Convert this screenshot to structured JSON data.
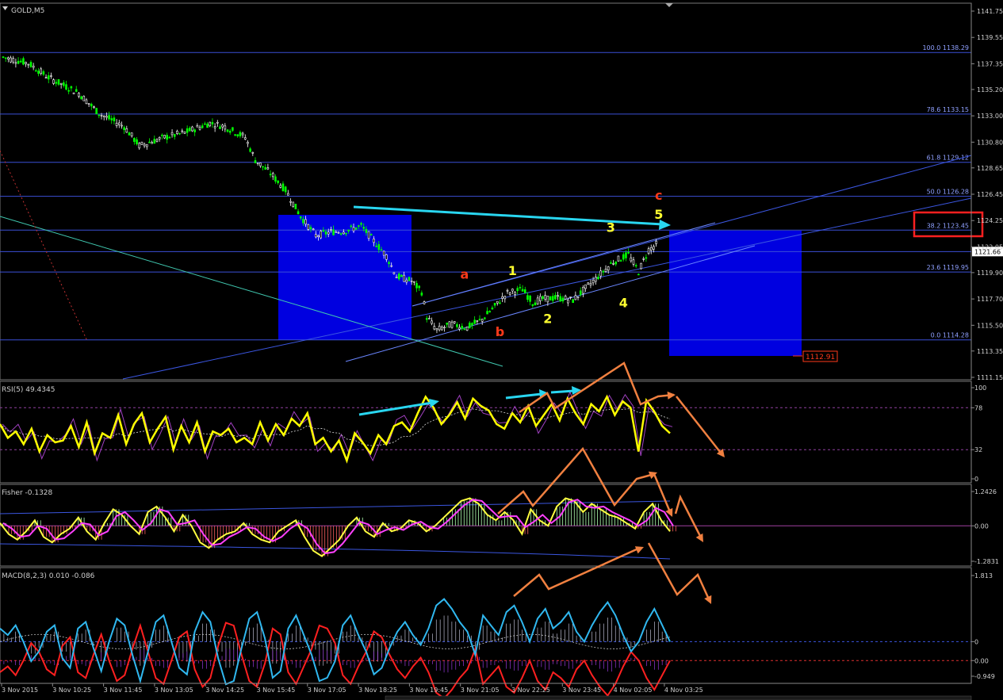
{
  "colors": {
    "background": "#000000",
    "grid": "#8a8a8a",
    "candle_up": "#00ff00",
    "candle_down": "#ffffff",
    "fib_line": "#3b4fd6",
    "zone": "#0000e0",
    "cyan_arrow": "#29d6f0",
    "orange_arrow": "#f08040",
    "rsi_line": "#ffff00",
    "rsi_aux": "#a040c0",
    "fisher_pos": "#b0ffb0",
    "fisher_neg": "#ff6060",
    "fisher_line": "#ffff40",
    "fisher_signal": "#ff40ff",
    "macd_main": "#30b8f0",
    "macd_signal": "#ff2020",
    "target_box": "#ff2020"
  },
  "chart_data": [
    {
      "type": "candlestick",
      "title": "GOLD,M5",
      "ylim": [
        1111.15,
        1141.75
      ],
      "y_ticks": [
        "1141.75",
        "1139.55",
        "1137.35",
        "1135.20",
        "1133.00",
        "1130.80",
        "1128.65",
        "1126.45",
        "1124.25",
        "1122.05",
        "1119.90",
        "1117.70",
        "1115.50",
        "1113.35",
        "1111.15"
      ],
      "x_ticks": [
        "3 Nov 2015",
        "3 Nov 10:25",
        "3 Nov 11:45",
        "3 Nov 13:05",
        "3 Nov 14:25",
        "3 Nov 15:45",
        "3 Nov 17:05",
        "3 Nov 18:25",
        "3 Nov 19:45",
        "3 Nov 21:05",
        "3 Nov 22:25",
        "3 Nov 23:45",
        "4 Nov 02:05",
        "4 Nov 03:25"
      ],
      "bars_count": 260,
      "close_path": [
        [
          0,
          1137.9
        ],
        [
          10,
          1137.4
        ],
        [
          18,
          1136.2
        ],
        [
          30,
          1134.9
        ],
        [
          38,
          1133.2
        ],
        [
          48,
          1132.1
        ],
        [
          54,
          1130.5
        ],
        [
          64,
          1131.2
        ],
        [
          72,
          1131.6
        ],
        [
          82,
          1132.4
        ],
        [
          88,
          1132.1
        ],
        [
          96,
          1131.2
        ],
        [
          100,
          1129.3
        ],
        [
          106,
          1128.2
        ],
        [
          112,
          1126.8
        ],
        [
          118,
          1124.6
        ],
        [
          124,
          1123.0
        ],
        [
          130,
          1123.3
        ],
        [
          136,
          1123.4
        ],
        [
          142,
          1123.8
        ],
        [
          146,
          1122.8
        ],
        [
          152,
          1121.3
        ],
        [
          156,
          1119.6
        ],
        [
          162,
          1119.2
        ],
        [
          166,
          1118.3
        ],
        [
          168,
          1116.2
        ],
        [
          172,
          1115.1
        ],
        [
          178,
          1115.6
        ],
        [
          184,
          1115.3
        ],
        [
          190,
          1116.0
        ],
        [
          196,
          1117.3
        ],
        [
          200,
          1118.2
        ],
        [
          206,
          1118.5
        ],
        [
          210,
          1117.4
        ],
        [
          214,
          1117.7
        ],
        [
          220,
          1117.8
        ],
        [
          226,
          1117.6
        ],
        [
          230,
          1118.4
        ],
        [
          236,
          1119.6
        ],
        [
          242,
          1120.8
        ],
        [
          248,
          1121.4
        ],
        [
          252,
          1120.0
        ],
        [
          256,
          1121.8
        ],
        [
          260,
          1122.4
        ],
        [
          263,
          1121.8
        ]
      ],
      "price_label": "1121.66",
      "fib_levels": [
        {
          "pct": "100.0",
          "value": "1138.29"
        },
        {
          "pct": "78.6",
          "value": "1133.15"
        },
        {
          "pct": "61.8",
          "value": "1129.12"
        },
        {
          "pct": "50.0",
          "value": "1126.28"
        },
        {
          "pct": "38.2",
          "value": "1123.45"
        },
        {
          "pct": "23.6",
          "value": "1119.95"
        },
        {
          "pct": "0.0",
          "value": "1114.28"
        }
      ],
      "extra_level": {
        "value": "1121.66"
      },
      "target_label": "1112.91",
      "wave_labels": [
        {
          "text": "a",
          "color": "#ff3a1a",
          "bar": 183,
          "price": 1119.4
        },
        {
          "text": "b",
          "color": "#ff3a1a",
          "bar": 197,
          "price": 1114.6
        },
        {
          "text": "c",
          "color": "#ff3a1a",
          "bar": 260,
          "price": 1126.0
        },
        {
          "text": "1",
          "color": "#ffff30",
          "bar": 202,
          "price": 1119.7
        },
        {
          "text": "2",
          "color": "#ffff30",
          "bar": 216,
          "price": 1115.7
        },
        {
          "text": "3",
          "color": "#ffff30",
          "bar": 241,
          "price": 1123.3
        },
        {
          "text": "4",
          "color": "#ffff30",
          "bar": 246,
          "price": 1117.0
        },
        {
          "text": "5",
          "color": "#ffff30",
          "bar": 260,
          "price": 1124.4
        }
      ]
    },
    {
      "type": "line",
      "title": "RSI(5) 49.4345",
      "ylim": [
        0,
        100
      ],
      "y_ticks": [
        "100",
        "78",
        "32",
        "0"
      ],
      "levels": [
        78,
        32
      ],
      "series": [
        {
          "values": [
            60,
            45,
            52,
            38,
            55,
            30,
            48,
            40,
            42,
            58,
            35,
            62,
            28,
            50,
            45,
            70,
            38,
            60,
            72,
            40,
            55,
            68,
            32,
            58,
            40,
            62,
            30,
            52,
            48,
            55,
            40,
            45,
            38,
            62,
            42,
            60,
            48,
            66,
            58,
            72,
            38,
            45,
            30,
            42,
            20,
            50,
            40,
            28,
            48,
            38,
            58,
            62,
            52,
            72,
            90,
            78,
            60,
            70,
            84,
            66,
            88,
            80,
            75,
            60,
            55,
            72,
            62,
            80,
            58,
            70,
            82,
            64,
            88,
            72,
            60,
            82,
            74,
            90,
            70,
            85,
            78,
            30,
            86,
            74,
            58,
            50
          ]
        }
      ]
    },
    {
      "type": "bar",
      "title": "Fisher -0.1328",
      "ylim": [
        -1.2831,
        1.2426
      ],
      "y_ticks": [
        "1.2426",
        "0.00",
        "-1.2831"
      ],
      "series": [
        {
          "values": [
            0.1,
            -0.3,
            -0.5,
            -0.2,
            0.2,
            -0.4,
            -0.6,
            -0.3,
            -0.1,
            0.3,
            -0.2,
            -0.5,
            0.1,
            0.6,
            0.4,
            0.0,
            -0.3,
            0.5,
            0.7,
            0.3,
            -0.2,
            0.4,
            0.0,
            -0.6,
            -0.8,
            -0.5,
            -0.3,
            -0.2,
            0.1,
            -0.3,
            -0.5,
            -0.6,
            -0.2,
            0.0,
            0.2,
            -0.4,
            -0.9,
            -1.1,
            -0.8,
            -0.5,
            0.0,
            0.3,
            -0.2,
            -0.4,
            0.1,
            -0.2,
            -0.1,
            0.2,
            0.1,
            -0.2,
            0.0,
            0.3,
            0.6,
            0.9,
            1.0,
            0.8,
            0.4,
            0.2,
            0.5,
            0.2,
            -0.3,
            0.6,
            0.2,
            0.0,
            0.7,
            1.0,
            0.9,
            0.5,
            0.8,
            0.6,
            0.4,
            0.3,
            0.1,
            -0.1,
            0.5,
            0.8,
            0.2,
            -0.2
          ]
        }
      ]
    },
    {
      "type": "bar",
      "title": "MACD(8,2,3) 0.010 -0.086",
      "ylim": [
        -0.949,
        1.813
      ],
      "y_ticks": [
        "1.813",
        "0",
        "0.00",
        "-0.949"
      ],
      "series": [
        {
          "values": [
            0.4,
            0.2,
            0.5,
            0.0,
            -0.6,
            -0.3,
            0.3,
            0.5,
            -0.5,
            -0.8,
            0.4,
            0.6,
            -0.2,
            -0.9,
            0.0,
            0.7,
            0.5,
            -0.4,
            -1.2,
            -0.3,
            0.6,
            0.8,
            0.0,
            -0.8,
            -1.0,
            0.3,
            0.9,
            0.6,
            -0.5,
            -1.3,
            -1.2,
            -0.2,
            0.7,
            0.9,
            0.1,
            -1.1,
            -0.9,
            0.4,
            0.8,
            0.2,
            -0.4,
            -1.2,
            -1.1,
            -0.6,
            0.5,
            0.8,
            0.2,
            -0.3,
            -1.0,
            -0.8,
            -0.2,
            0.3,
            0.6,
            0.2,
            -0.1,
            0.4,
            1.1,
            1.3,
            1.0,
            0.6,
            0.3,
            -0.4,
            0.8,
            0.5,
            0.2,
            0.9,
            1.1,
            0.6,
            0.0,
            0.7,
            1.0,
            0.4,
            0.6,
            0.9,
            0.3,
            0.0,
            0.5,
            0.9,
            1.2,
            0.8,
            0.2,
            -0.3,
            0.0,
            0.6,
            1.0,
            0.5,
            0.0
          ]
        }
      ]
    }
  ]
}
